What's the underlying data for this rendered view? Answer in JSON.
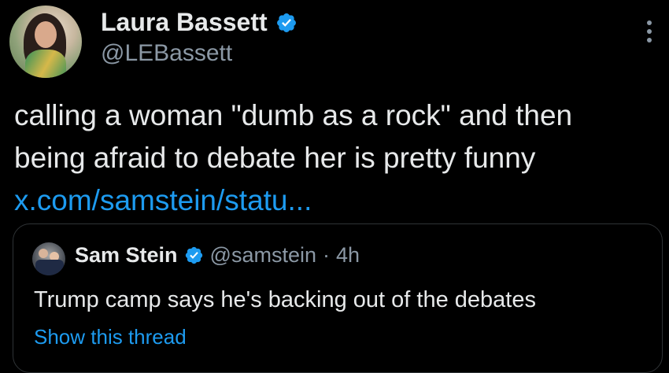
{
  "author": {
    "display_name": "Laura Bassett",
    "handle": "@LEBassett",
    "verified": true
  },
  "tweet": {
    "text_line1": "calling a woman \"dumb as a rock\" and then",
    "text_line2": "being afraid to debate her is pretty funny",
    "link": "x.com/samstein/statu..."
  },
  "quoted": {
    "display_name": "Sam Stein",
    "handle": "@samstein",
    "separator": "·",
    "time": "4h",
    "verified": true,
    "text": "Trump camp says he's backing out of the debates",
    "show_thread": "Show this thread"
  },
  "colors": {
    "background": "#000000",
    "text": "#e7e9ea",
    "muted": "#8b98a5",
    "link": "#1d9bf0",
    "border": "#2f3336"
  },
  "icons": {
    "verified": "verified-badge-icon",
    "more": "more-options-icon"
  }
}
